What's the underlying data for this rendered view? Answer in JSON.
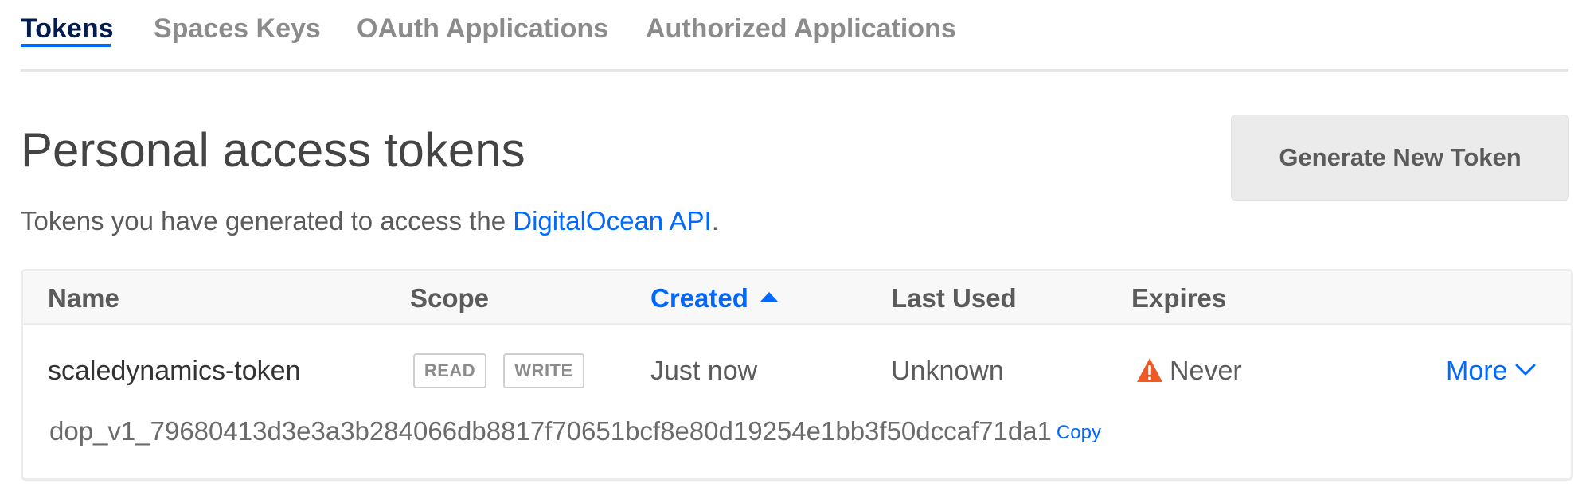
{
  "tabs": [
    {
      "label": "Tokens",
      "active": true
    },
    {
      "label": "Spaces Keys",
      "active": false
    },
    {
      "label": "OAuth Applications",
      "active": false
    },
    {
      "label": "Authorized Applications",
      "active": false
    }
  ],
  "header": {
    "title": "Personal access tokens",
    "subtitle_prefix": "Tokens you have generated to access the ",
    "subtitle_link": "DigitalOcean API",
    "subtitle_suffix": ".",
    "generate_button": "Generate New Token"
  },
  "table": {
    "columns": [
      "Name",
      "Scope",
      "Created",
      "Last Used",
      "Expires"
    ],
    "sorted_column": "Created",
    "sort_direction": "ascending",
    "rows": [
      {
        "name": "scaledynamics-token",
        "scopes": [
          "READ",
          "WRITE"
        ],
        "created": "Just now",
        "last_used": "Unknown",
        "expires": "Never",
        "expires_icon": "warning-icon",
        "more_label": "More",
        "token_value": "dop_v1_79680413d3e3a3b284066db8817f70651bcf8e80d19254e1bb3f50dccaf71da1",
        "copy_label": "Copy"
      }
    ]
  },
  "colors": {
    "accent": "#0069ff",
    "active_tab": "#031b4e",
    "warning": "#f15a24"
  }
}
